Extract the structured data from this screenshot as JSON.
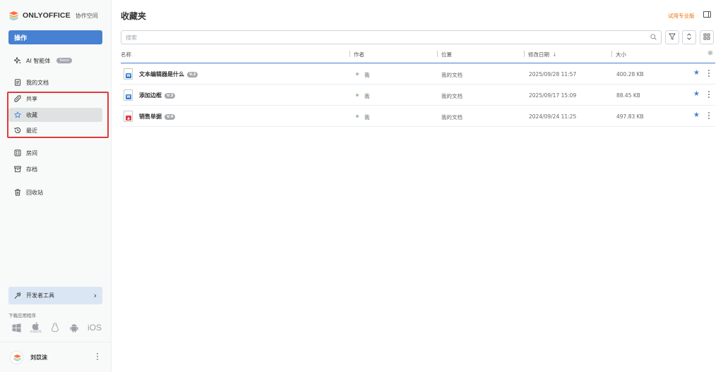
{
  "sidebar": {
    "logo_brand": "ONLYOFFICE",
    "logo_sub": "协作空间",
    "action_label": "操作",
    "ai_label": "AI 智能体",
    "ai_badge": "Soon",
    "items": [
      {
        "label": "我的文档",
        "icon": "document-icon"
      },
      {
        "label": "共享",
        "icon": "share-icon"
      },
      {
        "label": "收藏",
        "icon": "star-icon"
      },
      {
        "label": "最近",
        "icon": "history-icon"
      },
      {
        "label": "房间",
        "icon": "rooms-icon"
      },
      {
        "label": "存档",
        "icon": "archive-icon"
      },
      {
        "label": "回收站",
        "icon": "trash-icon"
      }
    ],
    "active_item": "收藏",
    "dev_tools_label": "开发者工具",
    "download_label": "下载应用程序",
    "os_labels": [
      "macOS",
      "iOS"
    ],
    "user_name": "刘苡沫"
  },
  "header": {
    "title": "收藏夹",
    "try_pro": "试用专业版"
  },
  "search": {
    "placeholder": "搜索"
  },
  "table": {
    "columns": [
      "名称",
      "作者",
      "位置",
      "修改日期",
      "大小"
    ],
    "sort_indicator": "↓",
    "rows": [
      {
        "name": "文本编辑器是什么",
        "version": "V.2",
        "type": "docx",
        "author": "我",
        "location": "我的文档",
        "modified": "2025/09/28 11:57",
        "size": "400.28 KB",
        "favorite": true
      },
      {
        "name": "添加边框",
        "version": "V.3",
        "type": "docx",
        "author": "我",
        "location": "我的文档",
        "modified": "2025/09/17 15:09",
        "size": "88.45 KB",
        "favorite": true
      },
      {
        "name": "销售单据",
        "version": "V.4",
        "type": "pdf",
        "author": "我",
        "location": "我的文档",
        "modified": "2024/09/24 11:25",
        "size": "497.83 KB",
        "favorite": true
      }
    ]
  },
  "colors": {
    "accent": "#4781d1",
    "highlight": "#e0393e",
    "pro": "#ed7309",
    "word": "#2b7ad3",
    "pdf": "#e0393e"
  }
}
